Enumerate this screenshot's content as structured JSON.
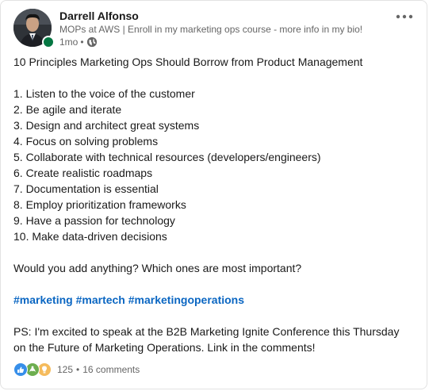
{
  "author": {
    "name": "Darrell Alfonso",
    "headline": "MOPs at AWS | Enroll in my marketing ops course - more info in my bio!",
    "time": "1mo",
    "separator": "•",
    "visibility_icon": "globe-icon"
  },
  "menu_icon": "more-horizontal-icon",
  "post": {
    "title": "10 Principles Marketing Ops Should Borrow from Product Management",
    "items": [
      "1. Listen to the voice of the customer",
      "2. Be agile and iterate",
      "3. Design and architect great systems",
      "4. Focus on solving problems",
      "5. Collaborate with technical resources (developers/engineers)",
      "6. Create realistic roadmaps",
      "7. Documentation is essential",
      "8. Employ prioritization frameworks",
      "9. Have a passion for technology",
      "10. Make data-driven decisions"
    ],
    "question": "Would you add anything? Which ones are most important?",
    "hashtags": [
      "#marketing",
      "#martech",
      "#marketingoperations"
    ],
    "ps_line1": "PS: I'm excited to speak at the B2B Marketing Ignite Conference this Thursday",
    "ps_line2": "on the Future of Marketing Operations. Link in the comments!"
  },
  "social": {
    "reaction_icons": [
      "like-icon",
      "support-icon",
      "insightful-icon"
    ],
    "reaction_count": "125",
    "separator": "•",
    "comments": "16 comments"
  },
  "colors": {
    "link": "#0a66c2",
    "presence": "#057642",
    "like": "#378fe9",
    "support": "#6dae4f",
    "insightful": "#f5bb5c"
  }
}
